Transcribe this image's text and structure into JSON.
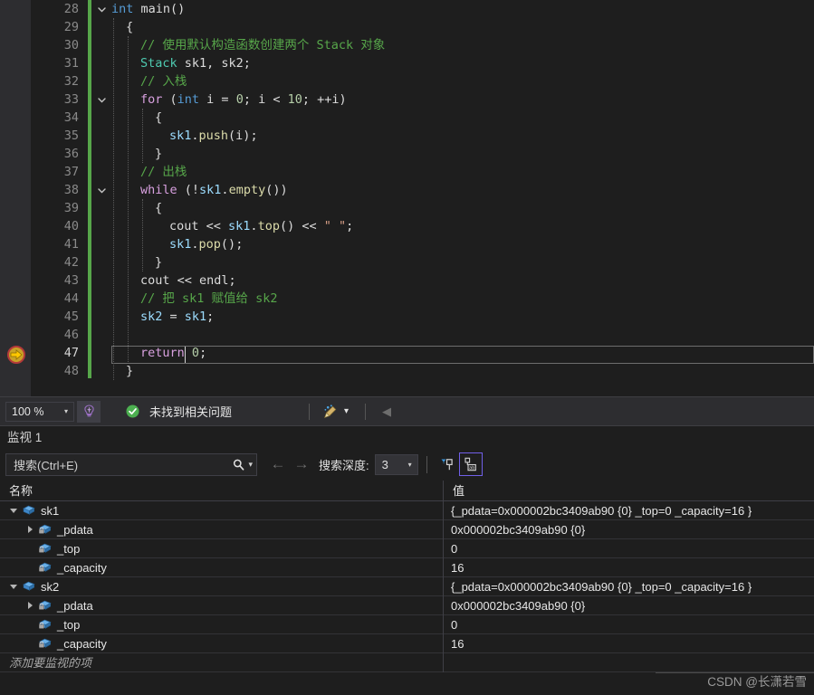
{
  "editor": {
    "first_line": 28,
    "current_line": 47,
    "zoom_level": "100 %",
    "lines": [
      {
        "num": 28,
        "tokens": [
          {
            "t": "int ",
            "c": "kw"
          },
          {
            "t": "main",
            "c": "id"
          },
          {
            "t": "()",
            "c": "pun"
          }
        ],
        "indent": 0,
        "fold": "open"
      },
      {
        "num": 29,
        "tokens": [
          {
            "t": "{",
            "c": "pun"
          }
        ],
        "indent": 1
      },
      {
        "num": 30,
        "tokens": [
          {
            "t": "// 使用默认构造函数创建两个 Stack 对象",
            "c": "cmt"
          }
        ],
        "indent": 2
      },
      {
        "num": 31,
        "tokens": [
          {
            "t": "Stack",
            "c": "typ"
          },
          {
            "t": " sk1, sk2",
            "c": "id"
          },
          {
            "t": ";",
            "c": "pun"
          }
        ],
        "indent": 2
      },
      {
        "num": 32,
        "tokens": [
          {
            "t": "// 入栈",
            "c": "cmt"
          }
        ],
        "indent": 2
      },
      {
        "num": 33,
        "tokens": [
          {
            "t": "for",
            "c": "kw2"
          },
          {
            "t": " (",
            "c": "pun"
          },
          {
            "t": "int",
            "c": "kw"
          },
          {
            "t": " i = ",
            "c": "id"
          },
          {
            "t": "0",
            "c": "num"
          },
          {
            "t": "; i < ",
            "c": "id"
          },
          {
            "t": "10",
            "c": "num"
          },
          {
            "t": "; ++i)",
            "c": "id"
          }
        ],
        "indent": 2,
        "fold": "open"
      },
      {
        "num": 34,
        "tokens": [
          {
            "t": "{",
            "c": "pun"
          }
        ],
        "indent": 3
      },
      {
        "num": 35,
        "tokens": [
          {
            "t": "sk1",
            "c": "var"
          },
          {
            "t": ".",
            "c": "pun"
          },
          {
            "t": "push",
            "c": "fn"
          },
          {
            "t": "(i)",
            "c": "pun"
          },
          {
            "t": ";",
            "c": "pun"
          }
        ],
        "indent": 4
      },
      {
        "num": 36,
        "tokens": [
          {
            "t": "}",
            "c": "pun"
          }
        ],
        "indent": 3
      },
      {
        "num": 37,
        "tokens": [
          {
            "t": "// 出栈",
            "c": "cmt"
          }
        ],
        "indent": 2
      },
      {
        "num": 38,
        "tokens": [
          {
            "t": "while",
            "c": "kw2"
          },
          {
            "t": " (!",
            "c": "pun"
          },
          {
            "t": "sk1",
            "c": "var"
          },
          {
            "t": ".",
            "c": "pun"
          },
          {
            "t": "empty",
            "c": "fn"
          },
          {
            "t": "())",
            "c": "pun"
          }
        ],
        "indent": 2,
        "fold": "open"
      },
      {
        "num": 39,
        "tokens": [
          {
            "t": "{",
            "c": "pun"
          }
        ],
        "indent": 3
      },
      {
        "num": 40,
        "tokens": [
          {
            "t": "cout",
            "c": "id"
          },
          {
            "t": " << ",
            "c": "pun"
          },
          {
            "t": "sk1",
            "c": "var"
          },
          {
            "t": ".",
            "c": "pun"
          },
          {
            "t": "top",
            "c": "fn"
          },
          {
            "t": "() << ",
            "c": "pun"
          },
          {
            "t": "\" \"",
            "c": "str"
          },
          {
            "t": ";",
            "c": "pun"
          }
        ],
        "indent": 4
      },
      {
        "num": 41,
        "tokens": [
          {
            "t": "sk1",
            "c": "var"
          },
          {
            "t": ".",
            "c": "pun"
          },
          {
            "t": "pop",
            "c": "fn"
          },
          {
            "t": "()",
            "c": "pun"
          },
          {
            "t": ";",
            "c": "pun"
          }
        ],
        "indent": 4
      },
      {
        "num": 42,
        "tokens": [
          {
            "t": "}",
            "c": "pun"
          }
        ],
        "indent": 3
      },
      {
        "num": 43,
        "tokens": [
          {
            "t": "cout",
            "c": "id"
          },
          {
            "t": " << ",
            "c": "pun"
          },
          {
            "t": "endl",
            "c": "id"
          },
          {
            "t": ";",
            "c": "pun"
          }
        ],
        "indent": 2
      },
      {
        "num": 44,
        "tokens": [
          {
            "t": "// 把 sk1 赋值给 sk2",
            "c": "cmt"
          }
        ],
        "indent": 2
      },
      {
        "num": 45,
        "tokens": [
          {
            "t": "sk2",
            "c": "var"
          },
          {
            "t": " = ",
            "c": "pun"
          },
          {
            "t": "sk1",
            "c": "var"
          },
          {
            "t": ";",
            "c": "pun"
          }
        ],
        "indent": 2
      },
      {
        "num": 46,
        "tokens": [],
        "indent": 2
      },
      {
        "num": 47,
        "tokens": [
          {
            "t": "return",
            "c": "kw2"
          },
          {
            "t": " ",
            "c": "pun"
          },
          {
            "t": "0",
            "c": "num"
          },
          {
            "t": ";",
            "c": "pun"
          }
        ],
        "indent": 2,
        "current": true
      },
      {
        "num": 48,
        "tokens": [
          {
            "t": "}",
            "c": "pun"
          }
        ],
        "indent": 1
      }
    ]
  },
  "statusbar": {
    "zoom": "100 %",
    "zoom_caret": "▾",
    "brain_icon": "intellicode-icon",
    "status_icon": "check-circle-icon",
    "status_text": "未找到相关问题",
    "broom_icon": "code-cleanup-icon",
    "broom_caret": "▾",
    "collapse_icon": "◀"
  },
  "watch": {
    "title": "监视 1",
    "search": {
      "placeholder": "搜索(Ctrl+E)",
      "value": "",
      "icon": "search-icon",
      "caret": "▾"
    },
    "nav_back": "←",
    "nav_forward": "→",
    "depth_label": "搜索深度:",
    "depth_value": "3",
    "depth_caret": "▾",
    "pin_icon": "pin-filter-icon",
    "hex_icon": "show-values-icon",
    "columns": {
      "name": "名称",
      "value": "值"
    },
    "rows": [
      {
        "name": "sk1",
        "value": "{_pdata=0x000002bc3409ab90 {0} _top=0 _capacity=16 }",
        "depth": 0,
        "twisty": "open",
        "icon": "variable-icon"
      },
      {
        "name": "_pdata",
        "value": "0x000002bc3409ab90 {0}",
        "depth": 1,
        "twisty": "closed",
        "icon": "private-variable-icon"
      },
      {
        "name": "_top",
        "value": "0",
        "depth": 1,
        "twisty": "none",
        "icon": "private-variable-icon"
      },
      {
        "name": "_capacity",
        "value": "16",
        "depth": 1,
        "twisty": "none",
        "icon": "private-variable-icon"
      },
      {
        "name": "sk2",
        "value": "{_pdata=0x000002bc3409ab90 {0} _top=0 _capacity=16 }",
        "depth": 0,
        "twisty": "open",
        "icon": "variable-icon"
      },
      {
        "name": "_pdata",
        "value": "0x000002bc3409ab90 {0}",
        "depth": 1,
        "twisty": "closed",
        "icon": "private-variable-icon"
      },
      {
        "name": "_top",
        "value": "0",
        "depth": 1,
        "twisty": "none",
        "icon": "private-variable-icon"
      },
      {
        "name": "_capacity",
        "value": "16",
        "depth": 1,
        "twisty": "none",
        "icon": "private-variable-icon"
      }
    ],
    "add_item_text": "添加要监视的项"
  },
  "watermark": "CSDN @长潇若雪",
  "colors": {
    "background": "#1e1e1e",
    "panel": "#2d2d30",
    "accent_green": "#57a64a",
    "accent_blue": "#569cd6",
    "comment": "#57a64a",
    "type": "#4ec9b0",
    "keyword2": "#d8a0df",
    "number": "#b5cea8",
    "string": "#d69d85",
    "variable": "#9cdcfe",
    "function": "#dcdcaa",
    "exec_arrow": "#ffc700",
    "pin_blue": "#3a96dd",
    "focus_purple": "#7160e8"
  }
}
